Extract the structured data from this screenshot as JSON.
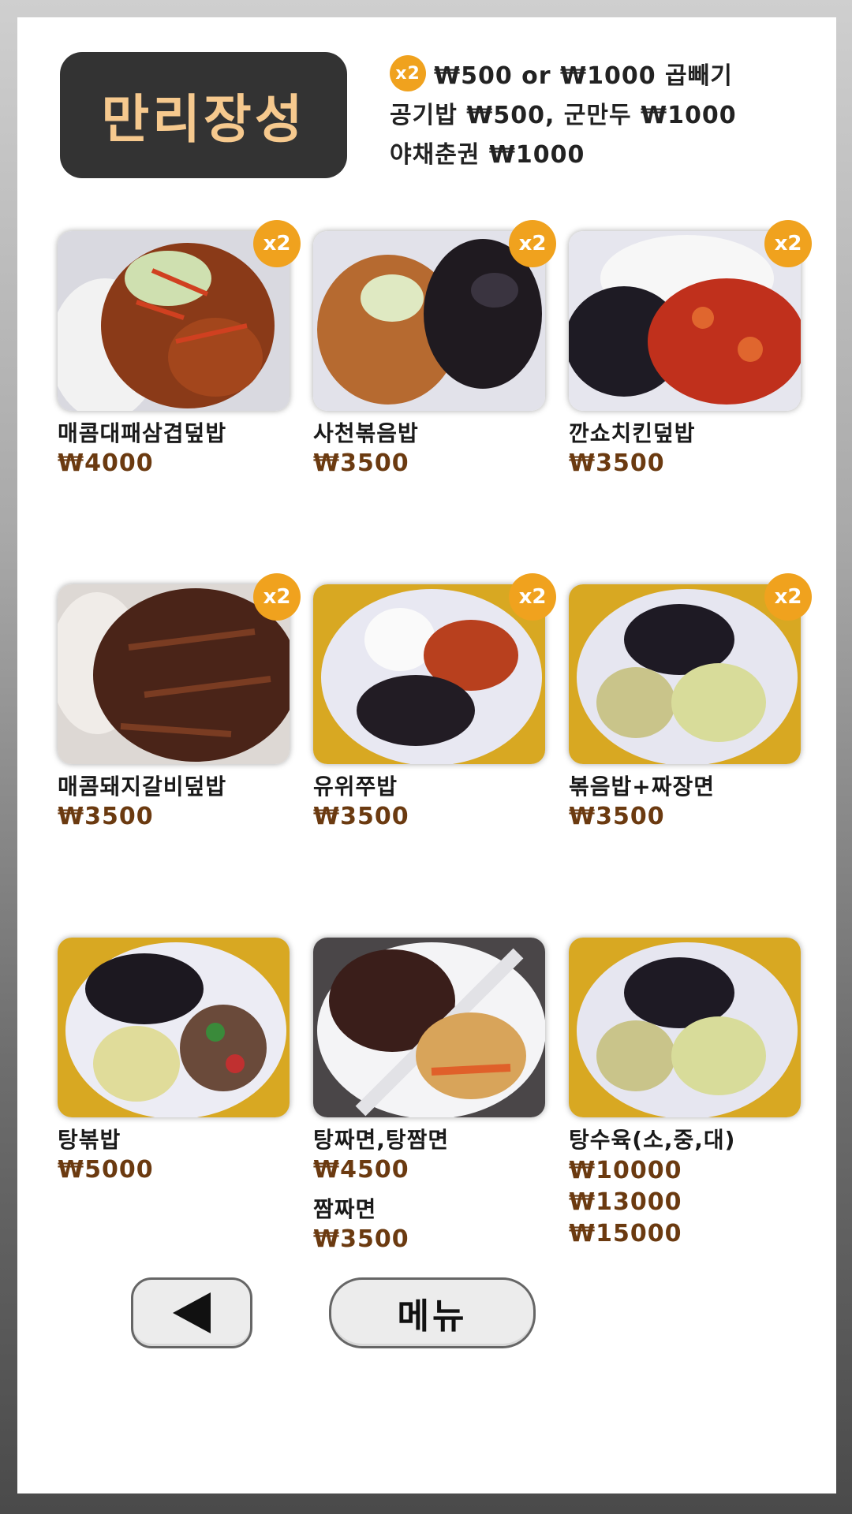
{
  "brand": {
    "name": "만리장성"
  },
  "info": {
    "badge": "x2",
    "line1": "₩500 or ₩1000 곱빼기",
    "line2": "공기밥 ₩500, 군만두 ₩1000",
    "line3": "야채춘권 ₩1000"
  },
  "items": [
    {
      "name": "매콤대패삼겹덮밥",
      "price": "₩4000",
      "badge": "x2"
    },
    {
      "name": "사천볶음밥",
      "price": "₩3500",
      "badge": "x2"
    },
    {
      "name": "깐쇼치킨덮밥",
      "price": "₩3500",
      "badge": "x2"
    },
    {
      "name": "매콤돼지갈비덮밥",
      "price": "₩3500",
      "badge": "x2"
    },
    {
      "name": "유위쭈밥",
      "price": "₩3500",
      "badge": "x2"
    },
    {
      "name": "볶음밥+짜장면",
      "price": "₩3500",
      "badge": "x2"
    },
    {
      "name": "탕볶밥",
      "price": "₩5000"
    },
    {
      "name": "탕짜면,탕짬면",
      "price": "₩4500",
      "sub_name": "짬짜면",
      "sub_price": "₩3500"
    },
    {
      "name": "탕수육(소,중,대)",
      "prices": [
        "₩10000",
        "₩13000",
        "₩15000"
      ]
    }
  ],
  "nav": {
    "back_icon": "left-triangle-icon",
    "menu_label": "메뉴"
  },
  "colors": {
    "badge": "#f0a21e",
    "brand_bg": "#333333",
    "brand_text": "#f6c98e",
    "price": "#6b3a10"
  }
}
